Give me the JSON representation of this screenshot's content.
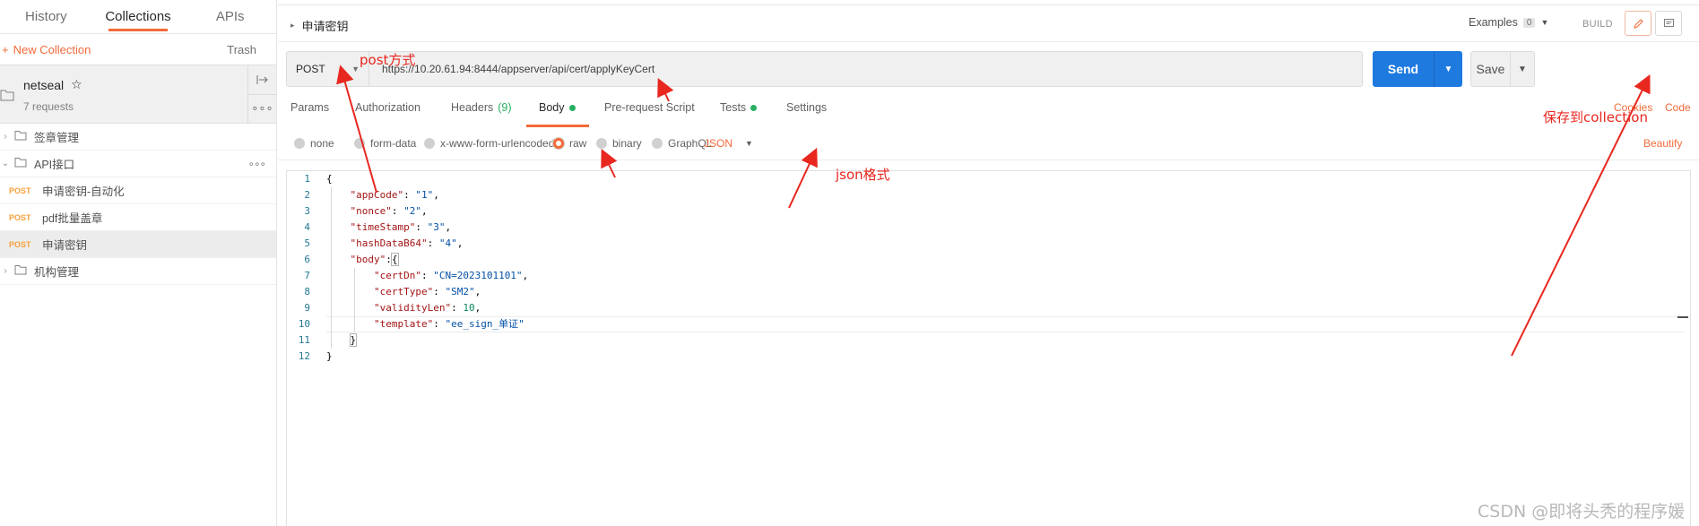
{
  "sidebar": {
    "tabs": [
      {
        "label": "History"
      },
      {
        "label": "Collections",
        "active": true
      },
      {
        "label": "APIs"
      }
    ],
    "new_collection": "New Collection",
    "trash": "Trash",
    "collection": {
      "name": "netseal",
      "count": "7 requests"
    },
    "tree": [
      {
        "type": "folder",
        "label": "签章管理"
      },
      {
        "type": "folder",
        "label": "API接口",
        "expanded": true
      },
      {
        "type": "request",
        "method": "POST",
        "label": "申请密钥-自动化"
      },
      {
        "type": "request",
        "method": "POST",
        "label": "pdf批量盖章"
      },
      {
        "type": "request",
        "method": "POST",
        "label": "申请密钥",
        "selected": true
      },
      {
        "type": "folder",
        "label": "机构管理"
      }
    ]
  },
  "request": {
    "title": "申请密钥",
    "examples_label": "Examples",
    "examples_count": "0",
    "build_label": "BUILD",
    "method": "POST",
    "url": "https://10.20.61.94:8444/appserver/api/cert/applyKeyCert",
    "send_label": "Send",
    "save_label": "Save",
    "tabs": {
      "params": "Params",
      "authorization": "Authorization",
      "headers": "Headers",
      "headers_count": "(9)",
      "body": "Body",
      "prerequest": "Pre-request Script",
      "tests": "Tests",
      "settings": "Settings"
    },
    "cookies_label": "Cookies",
    "code_label": "Code",
    "body_types": {
      "none": "none",
      "form_data": "form-data",
      "urlencoded": "x-www-form-urlencoded",
      "raw": "raw",
      "binary": "binary",
      "graphql": "GraphQL",
      "selected": "raw",
      "format": "JSON"
    },
    "beautify_label": "Beautify"
  },
  "editor": {
    "line_numbers": [
      "1",
      "2",
      "3",
      "4",
      "5",
      "6",
      "7",
      "8",
      "9",
      "10",
      "11",
      "12"
    ],
    "code": {
      "l1": "{",
      "l2_key": "\"appCode\"",
      "l2_val": "\"1\"",
      "l3_key": "\"nonce\"",
      "l3_val": "\"2\"",
      "l4_key": "\"timeStamp\"",
      "l4_val": "\"3\"",
      "l5_key": "\"hashDataB64\"",
      "l5_val": "\"4\"",
      "l6_key": "\"body\"",
      "l6_val": "{",
      "l7_key": "\"certDn\"",
      "l7_val": "\"CN=2023101101\"",
      "l8_key": "\"certType\"",
      "l8_val": "\"SM2\"",
      "l9_key": "\"validityLen\"",
      "l9_val": "10",
      "l10_key": "\"template\"",
      "l10_val": "\"ee_sign_单证\"",
      "l11": "}",
      "l12": "}"
    }
  },
  "annotations": {
    "post_method": "post方式",
    "json_format": "json格式",
    "save_to_collection": "保存到collection",
    "color": "#e8271f"
  },
  "watermark": "CSDN @即将头秃的程序媛"
}
